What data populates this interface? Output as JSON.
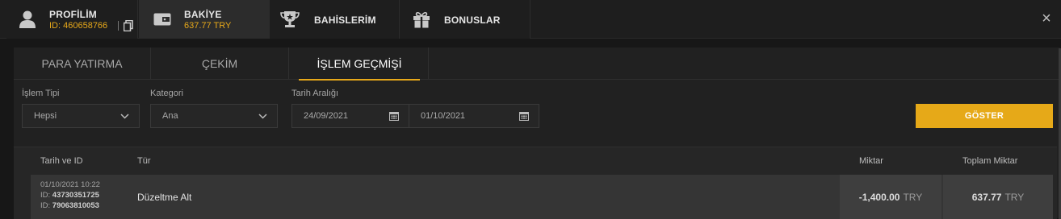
{
  "header": {
    "profile": {
      "label": "PROFİLİM",
      "id_text": "ID: 460658766"
    },
    "balance": {
      "label": "BAKİYE",
      "amount": "637.77 TRY"
    },
    "bets": {
      "label": "BAHİSLERİM"
    },
    "bonuses": {
      "label": "BONUSLAR"
    },
    "close": "×"
  },
  "subtabs": [
    {
      "label": "PARA YATIRMA"
    },
    {
      "label": "ÇEKİM"
    },
    {
      "label": "İŞLEM GEÇMİŞİ"
    }
  ],
  "filters": {
    "type_label": "İşlem Tipi",
    "type_value": "Hepsi",
    "category_label": "Kategori",
    "category_value": "Ana",
    "date_label": "Tarih Aralığı",
    "date_from": "24/09/2021",
    "date_to": "01/10/2021",
    "show_button": "GÖSTER"
  },
  "table": {
    "columns": {
      "date_id": "Tarih ve ID",
      "type": "Tür",
      "amount": "Miktar",
      "total": "Toplam Miktar"
    },
    "rows": [
      {
        "datetime": "01/10/2021 10:22",
        "id1_label": "ID:",
        "id1": "43730351725",
        "id2_label": "ID:",
        "id2": "79063810053",
        "type": "Düzeltme Alt",
        "amount": "-1,400.00",
        "amount_currency": "TRY",
        "total": "637.77",
        "total_currency": "TRY"
      }
    ]
  },
  "colors": {
    "accent": "#e8a91a",
    "background": "#171717",
    "panel": "#212121"
  }
}
